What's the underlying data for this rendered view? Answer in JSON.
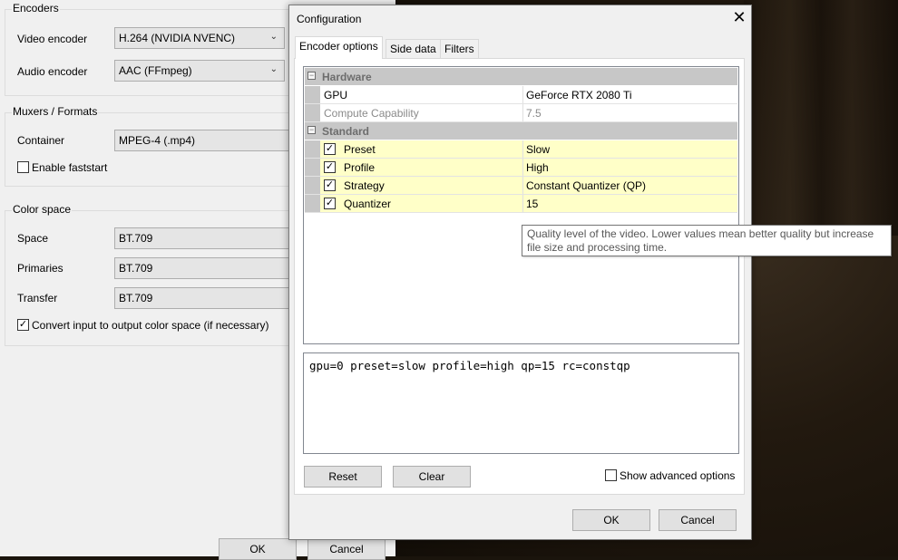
{
  "left_window": {
    "encoders": {
      "title": "Encoders",
      "video_label": "Video encoder",
      "video_value": "H.264 (NVIDIA NVENC)",
      "audio_label": "Audio encoder",
      "audio_value": "AAC (FFmpeg)"
    },
    "muxers": {
      "title": "Muxers / Formats",
      "container_label": "Container",
      "container_value": "MPEG-4 (.mp4)",
      "faststart_label": "Enable faststart",
      "faststart_checked": false
    },
    "color_space": {
      "title": "Color space",
      "space_label": "Space",
      "space_value": "BT.709",
      "primaries_label": "Primaries",
      "primaries_value": "BT.709",
      "transfer_label": "Transfer",
      "transfer_value": "BT.709",
      "convert_label": "Convert input to output color space (if necessary)",
      "convert_checked": true
    },
    "ok_label": "OK",
    "cancel_label": "Cancel"
  },
  "dialog": {
    "title": "Configuration",
    "tabs": [
      "Encoder options",
      "Side data",
      "Filters"
    ],
    "active_tab": "Encoder options",
    "categories": {
      "hardware": "Hardware",
      "standard": "Standard"
    },
    "hardware_props": [
      {
        "name": "GPU",
        "value": "GeForce RTX 2080 Ti"
      },
      {
        "name": "Compute Capability",
        "value": "7.5"
      }
    ],
    "standard_props": [
      {
        "name": "Preset",
        "value": "Slow",
        "checked": true
      },
      {
        "name": "Profile",
        "value": "High",
        "checked": true
      },
      {
        "name": "Strategy",
        "value": "Constant Quantizer (QP)",
        "checked": true
      },
      {
        "name": "Quantizer",
        "value": "15",
        "checked": true
      }
    ],
    "tooltip": "Quality level of the video. Lower values mean better quality but increase file size and processing time.",
    "command_line": "gpu=0 preset=slow profile=high qp=15 rc=constqp",
    "reset_label": "Reset",
    "clear_label": "Clear",
    "advanced_label": "Show advanced options",
    "advanced_checked": false,
    "ok_label": "OK",
    "cancel_label": "Cancel"
  },
  "colors": {
    "checked_row": "#ffffc8",
    "category_bg": "#c7c7c7"
  }
}
